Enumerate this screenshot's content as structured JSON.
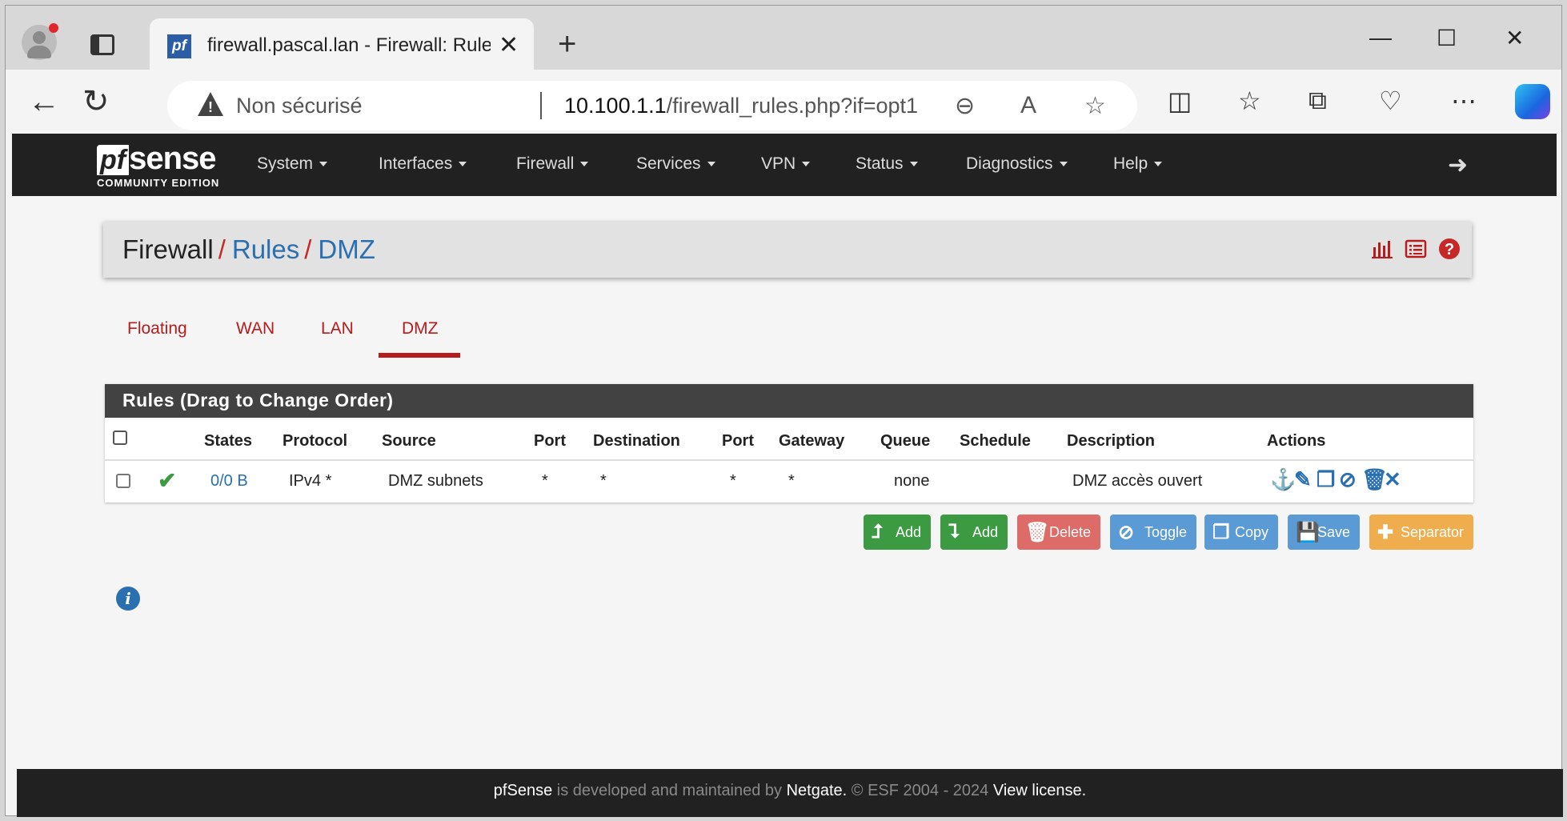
{
  "browser": {
    "tab_title": "firewall.pascal.lan - Firewall: Rules: DMZ",
    "favicon_text": "pf",
    "security_label": "Non sécurisé",
    "url_host": "10.100.1.1",
    "url_path": "/firewall_rules.php?if=opt1"
  },
  "nav": {
    "logo_pf": "pf",
    "logo_sense": "sense",
    "logo_edition": "COMMUNITY EDITION",
    "menus": [
      "System",
      "Interfaces",
      "Firewall",
      "Services",
      "VPN",
      "Status",
      "Diagnostics",
      "Help"
    ]
  },
  "breadcrumb": {
    "root": "Firewall",
    "level1": "Rules",
    "level2": "DMZ",
    "separator": "/"
  },
  "tabs": [
    "Floating",
    "WAN",
    "LAN",
    "DMZ"
  ],
  "active_tab": "DMZ",
  "rules_panel": {
    "title": "Rules (Drag to Change Order)",
    "columns": [
      "States",
      "Protocol",
      "Source",
      "Port",
      "Destination",
      "Port",
      "Gateway",
      "Queue",
      "Schedule",
      "Description",
      "Actions"
    ],
    "rows": [
      {
        "states": "0/0 B",
        "protocol": "IPv4 *",
        "source": "DMZ subnets",
        "source_port": "*",
        "destination": "*",
        "destination_port": "*",
        "gateway": "*",
        "queue": "none",
        "schedule": "",
        "description": "DMZ accès ouvert",
        "enabled": true
      }
    ]
  },
  "buttons": {
    "add_top": "Add",
    "add_bottom": "Add",
    "delete": "Delete",
    "toggle": "Toggle",
    "copy": "Copy",
    "save": "Save",
    "separator": "Separator"
  },
  "colors": {
    "brand_dark": "#212121",
    "link_blue": "#2a6fb0",
    "accent_red": "#b71c1c",
    "success_green": "#3c9b42",
    "info_blue": "#5b9bd5",
    "warning_orange": "#f0ad4e",
    "danger_red": "#d9534f"
  },
  "footer": {
    "brand": "pfSense",
    "text1": " is developed and maintained by ",
    "company": "Netgate.",
    "text2": " © ESF 2004 - 2024 ",
    "license": "View license."
  }
}
